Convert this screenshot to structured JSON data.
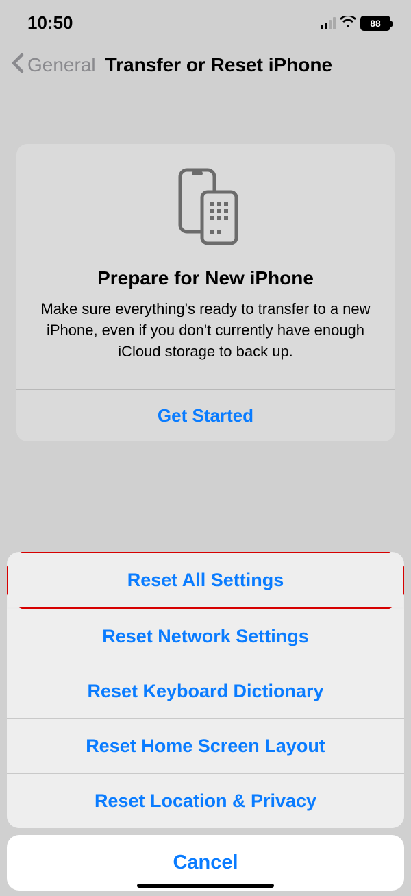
{
  "status": {
    "time": "10:50",
    "battery": "88"
  },
  "nav": {
    "back": "General",
    "title": "Transfer or Reset iPhone"
  },
  "card": {
    "title": "Prepare for New iPhone",
    "desc": "Make sure everything's ready to transfer to a new iPhone, even if you don't currently have enough iCloud storage to back up.",
    "cta": "Get Started"
  },
  "sheet": {
    "items": [
      "Reset All Settings",
      "Reset Network Settings",
      "Reset Keyboard Dictionary",
      "Reset Home Screen Layout",
      "Reset Location & Privacy"
    ],
    "cancel": "Cancel"
  }
}
